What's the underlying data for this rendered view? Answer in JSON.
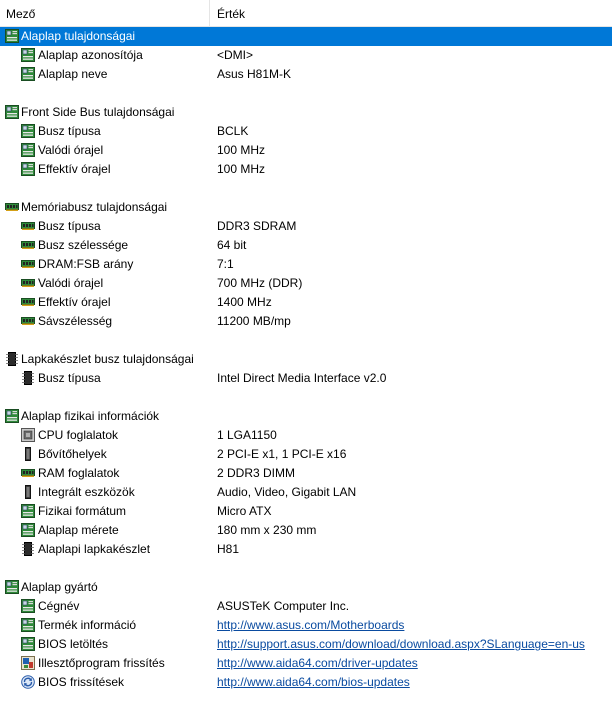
{
  "header": {
    "field_label": "Mező",
    "value_label": "Érték"
  },
  "rows": [
    {
      "type": "section",
      "icon": "motherboard-icon",
      "label": "Alaplap tulajdonságai",
      "selected": true
    },
    {
      "type": "item",
      "icon": "motherboard-icon",
      "label": "Alaplap azonosítója",
      "value": "<DMI>"
    },
    {
      "type": "item",
      "icon": "motherboard-icon",
      "label": "Alaplap neve",
      "value": "Asus H81M-K"
    },
    {
      "type": "gap"
    },
    {
      "type": "section",
      "icon": "motherboard-icon",
      "label": "Front Side Bus tulajdonságai"
    },
    {
      "type": "item",
      "icon": "motherboard-icon",
      "label": "Busz típusa",
      "value": "BCLK"
    },
    {
      "type": "item",
      "icon": "motherboard-icon",
      "label": "Valódi órajel",
      "value": "100 MHz"
    },
    {
      "type": "item",
      "icon": "motherboard-icon",
      "label": "Effektív órajel",
      "value": "100 MHz"
    },
    {
      "type": "gap"
    },
    {
      "type": "section",
      "icon": "memory-icon",
      "label": "Memóriabusz tulajdonságai"
    },
    {
      "type": "item",
      "icon": "memory-icon",
      "label": "Busz típusa",
      "value": "DDR3 SDRAM"
    },
    {
      "type": "item",
      "icon": "memory-icon",
      "label": "Busz szélessége",
      "value": "64 bit"
    },
    {
      "type": "item",
      "icon": "memory-icon",
      "label": "DRAM:FSB arány",
      "value": "7:1"
    },
    {
      "type": "item",
      "icon": "memory-icon",
      "label": "Valódi órajel",
      "value": "700 MHz (DDR)"
    },
    {
      "type": "item",
      "icon": "memory-icon",
      "label": "Effektív órajel",
      "value": "1400 MHz"
    },
    {
      "type": "item",
      "icon": "memory-icon",
      "label": "Sávszélesség",
      "value": "11200 MB/mp"
    },
    {
      "type": "gap"
    },
    {
      "type": "section",
      "icon": "chipset-icon",
      "label": "Lapkakészlet busz tulajdonságai"
    },
    {
      "type": "item",
      "icon": "chipset-icon",
      "label": "Busz típusa",
      "value": "Intel Direct Media Interface v2.0"
    },
    {
      "type": "gap"
    },
    {
      "type": "section",
      "icon": "motherboard-icon",
      "label": "Alaplap fizikai információk"
    },
    {
      "type": "item",
      "icon": "cpu-icon",
      "label": "CPU foglalatok",
      "value": "1 LGA1150"
    },
    {
      "type": "item",
      "icon": "expansion-slot-icon",
      "label": "Bővítőhelyek",
      "value": "2 PCI-E x1, 1 PCI-E x16"
    },
    {
      "type": "item",
      "icon": "memory-icon",
      "label": "RAM foglalatok",
      "value": "2 DDR3 DIMM"
    },
    {
      "type": "item",
      "icon": "expansion-slot-icon",
      "label": "Integrált eszközök",
      "value": "Audio, Video, Gigabit LAN"
    },
    {
      "type": "item",
      "icon": "motherboard-icon",
      "label": "Fizikai formátum",
      "value": "Micro ATX"
    },
    {
      "type": "item",
      "icon": "motherboard-icon",
      "label": "Alaplap mérete",
      "value": "180 mm x 230 mm"
    },
    {
      "type": "item",
      "icon": "chipset-icon",
      "label": "Alaplapi lapkakészlet",
      "value": "H81"
    },
    {
      "type": "gap"
    },
    {
      "type": "section",
      "icon": "motherboard-icon",
      "label": "Alaplap gyártó"
    },
    {
      "type": "item",
      "icon": "motherboard-icon",
      "label": "Cégnév",
      "value": "ASUSTeK Computer Inc."
    },
    {
      "type": "item",
      "icon": "motherboard-icon",
      "label": "Termék információ",
      "value": "http://www.asus.com/Motherboards",
      "link": true
    },
    {
      "type": "item",
      "icon": "motherboard-icon",
      "label": "BIOS letöltés",
      "value": "http://support.asus.com/download/download.aspx?SLanguage=en-us",
      "link": true
    },
    {
      "type": "item",
      "icon": "driver-update-icon",
      "label": "Illesztőprogram frissítés",
      "value": "http://www.aida64.com/driver-updates",
      "link": true
    },
    {
      "type": "item",
      "icon": "bios-update-icon",
      "label": "BIOS frissítések",
      "value": "http://www.aida64.com/bios-updates",
      "link": true
    }
  ]
}
